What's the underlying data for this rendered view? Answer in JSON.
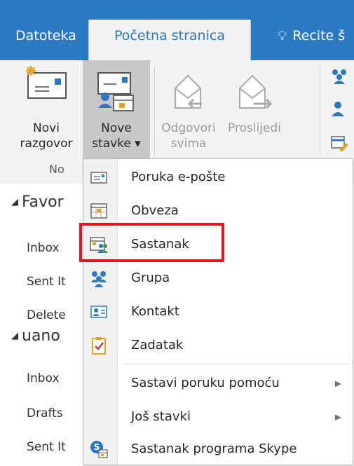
{
  "tabs": {
    "file": "Datoteka",
    "home": "Početna stranica",
    "tell": "Recite š"
  },
  "ribbon": {
    "new_conversation": [
      "Novi",
      "razgovor"
    ],
    "new_items": [
      "Nove",
      "stavke ▾"
    ],
    "reply_all": [
      "Odgovori",
      "svima"
    ],
    "forward": "Proslijedi",
    "group_label": "No"
  },
  "nav": {
    "favorites": "Favor",
    "inbox": "Inbox",
    "sent": "Sent It",
    "deleted": "Delete",
    "account": "uano",
    "inbox2": "Inbox",
    "drafts": "Drafts",
    "sent2": "Sent It"
  },
  "menu": {
    "items": [
      {
        "label": "Poruka e-pošte",
        "icon": "email-message-icon"
      },
      {
        "label": "Obveza",
        "icon": "calendar-appointment-icon"
      },
      {
        "label": "Sastanak",
        "icon": "meeting-icon"
      },
      {
        "label": "Grupa",
        "icon": "group-icon"
      },
      {
        "label": "Kontakt",
        "icon": "contact-card-icon"
      },
      {
        "label": "Zadatak",
        "icon": "task-icon"
      },
      {
        "label": "Sastavi poruku pomoću",
        "icon": ""
      },
      {
        "label": "Još stavki",
        "icon": ""
      },
      {
        "label": "Sastanak programa Skype",
        "icon": "skype-meeting-icon"
      }
    ]
  },
  "colors": {
    "accent": "#2b79c2",
    "highlight": "#e8141b",
    "ribbon_bg": "#f3f3f3"
  }
}
